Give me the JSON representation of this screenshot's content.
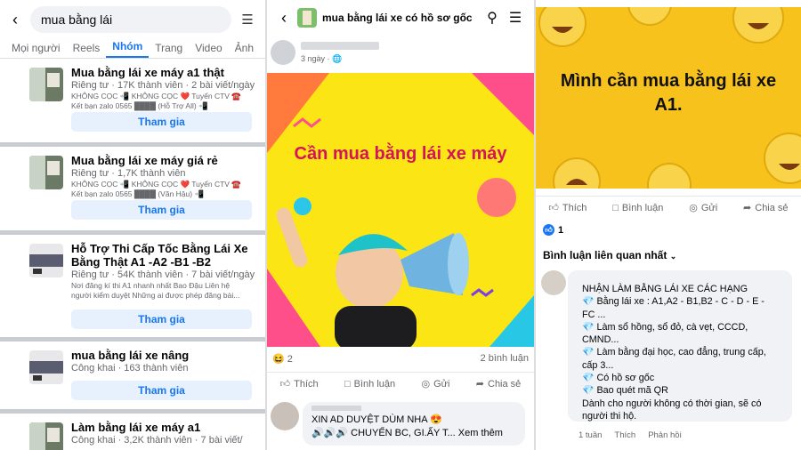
{
  "search": {
    "query": "mua bằng lái"
  },
  "tabs": [
    "Mọi người",
    "Reels",
    "Nhóm",
    "Trang",
    "Video",
    "Ảnh"
  ],
  "groups": [
    {
      "name": "Mua bằng lái xe máy a1 thật",
      "meta": "Riêng tư · 17K thành viên · 2 bài viết/ngày",
      "desc1": "KHÔNG CỌC 📲 KHÔNG CỌC ❤️ Tuyển CTV ☎️",
      "desc2": "Kết bạn zalo 0565 ████ (Hỗ Trợ All) 📲",
      "join": "Tham gia"
    },
    {
      "name": "Mua bằng lái xe máy giá rẻ",
      "meta": "Riêng tư · 1,7K thành viên",
      "desc1": "KHÔNG CỌC 📲 KHÔNG CỌC ❤️ Tuyển CTV ☎️",
      "desc2": "Kết bạn zalo 0565 ████ (Văn Hậu) 📲",
      "join": "Tham gia"
    },
    {
      "name": "Hỗ Trợ Thi Cấp Tốc Bằng Lái Xe Bằng Thật A1 -A2 -B1 -B2",
      "meta": "Riêng tư · 54K thành viên · 7 bài viết/ngày",
      "desc1": "Nơi đăng kí thi A1 nhanh nhất Bao Đậu Liên hệ",
      "desc2": "người kiểm duyệt Những ai được phép đăng bài...",
      "join": "Tham gia"
    },
    {
      "name": "mua bằng lái xe nâng",
      "meta": "Công khai · 163 thành viên",
      "desc1": "",
      "desc2": "",
      "join": "Tham gia"
    },
    {
      "name": "Làm bằng lái xe máy a1",
      "meta": "Công khai · 3,2K thành viên · 7 bài viết/",
      "desc1": "",
      "desc2": "",
      "join": ""
    }
  ],
  "post": {
    "title": "mua bằng lái xe có hồ sơ gốc",
    "time": "3 ngày · 🌐",
    "image_text": "Cần mua bằng lái xe máy",
    "reaction_emoji": "😆",
    "reaction_count": "2",
    "comment_count": "2 bình luận",
    "actions": {
      "like": "Thích",
      "comment": "Bình luận",
      "send": "Gửi",
      "share": "Chia sẻ"
    },
    "comment_line1": "XIN AD DUYỆT DÙM NHA 😍",
    "comment_line2": "🔊🔊🔊 CHUYỂN BC, GI.ẤY T... Xem thêm"
  },
  "post2": {
    "image_text": "Mình cần mua bằng lái xe A1.",
    "actions": {
      "like": "Thích",
      "comment": "Bình luận",
      "send": "Gửi",
      "share": "Chia sẻ"
    },
    "reaction_count": "1",
    "sort_label": "Bình luận liên quan nhất",
    "comment_lines": [
      "NHẬN LÀM BẰNG LÁI XE CÁC HẠNG",
      "💎 Bằng lái xe : A1,A2 - B1,B2 - C - D - E -",
      "FC ...",
      "💎 Làm sổ hồng, sổ đỏ, cà vẹt, CCCD,",
      "CMND...",
      "💎 Làm bằng đại học, cao đẳng, trung cấp,",
      "cấp 3...",
      "💎 Có hồ sơ gốc",
      "💎 Bao quét mã QR",
      "Dành cho người không có thời gian, sẽ có",
      "người thi hộ."
    ],
    "comment_time": "1 tuần",
    "comment_like": "Thích",
    "comment_reply": "Phản hồi"
  }
}
